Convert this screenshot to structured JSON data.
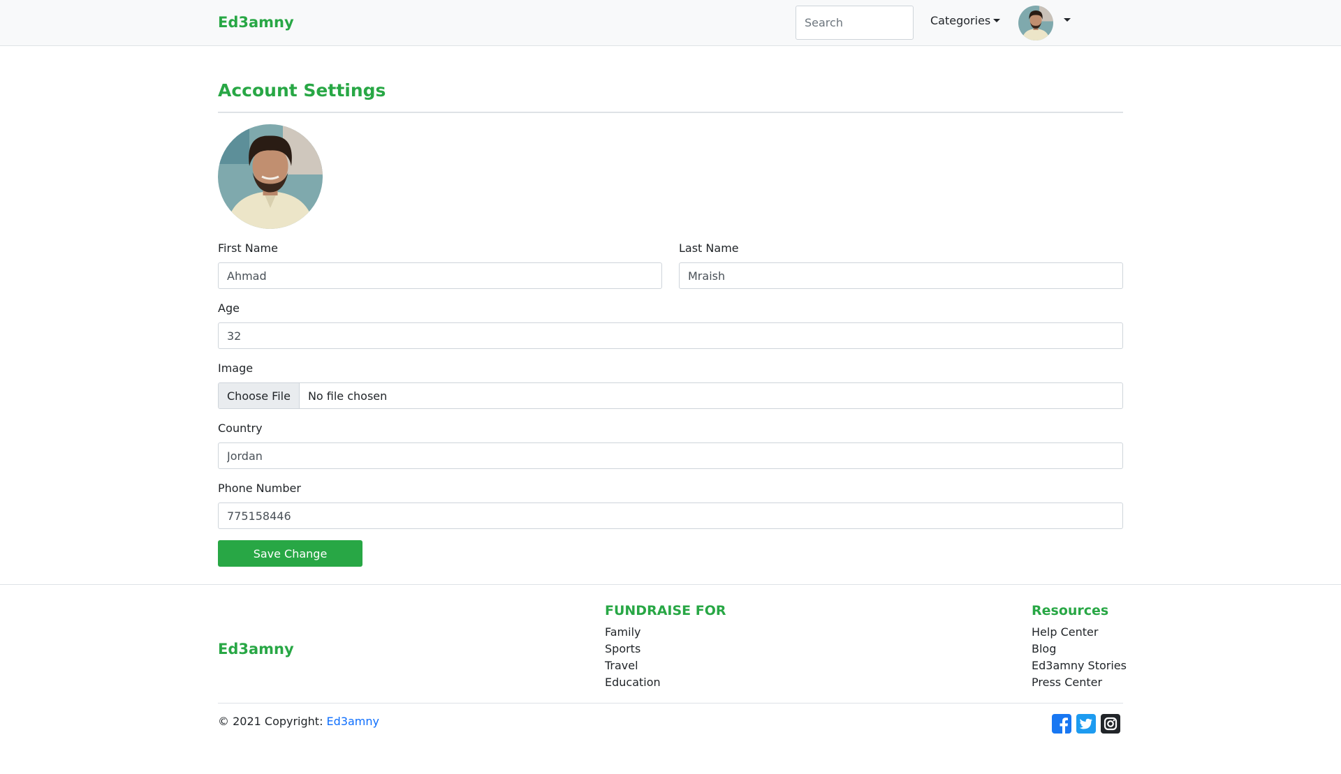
{
  "navbar": {
    "brand": "Ed3amny",
    "search_placeholder": "Search",
    "categories_label": "Categories"
  },
  "page": {
    "title": "Account Settings"
  },
  "form": {
    "first_name": {
      "label": "First Name",
      "value": "Ahmad"
    },
    "last_name": {
      "label": "Last Name",
      "value": "Mraish"
    },
    "age": {
      "label": "Age",
      "value": "32"
    },
    "image": {
      "label": "Image",
      "button": "Choose File",
      "status": "No file chosen"
    },
    "country": {
      "label": "Country",
      "value": "Jordan"
    },
    "phone": {
      "label": "Phone Number",
      "value": "775158446"
    },
    "save_label": "Save Change"
  },
  "footer": {
    "brand": "Ed3amny",
    "fundraise": {
      "heading": "FUNDRAISE FOR",
      "items": [
        "Family",
        "Sports",
        "Travel",
        "Education"
      ]
    },
    "resources": {
      "heading": "Resources",
      "items": [
        "Help Center",
        "Blog",
        "Ed3amny Stories",
        "Press Center"
      ]
    },
    "copyright_prefix": "© 2021 Copyright: ",
    "copyright_link": "Ed3amny",
    "social": [
      {
        "icon": "facebook-icon",
        "color": "#1877f2"
      },
      {
        "icon": "twitter-icon",
        "color": "#1d9bf0"
      },
      {
        "icon": "instagram-icon",
        "color": "#212529"
      }
    ]
  },
  "colors": {
    "brand": "#28a745",
    "link": "#0d6efd",
    "navbar_bg": "#f8f9fa"
  }
}
